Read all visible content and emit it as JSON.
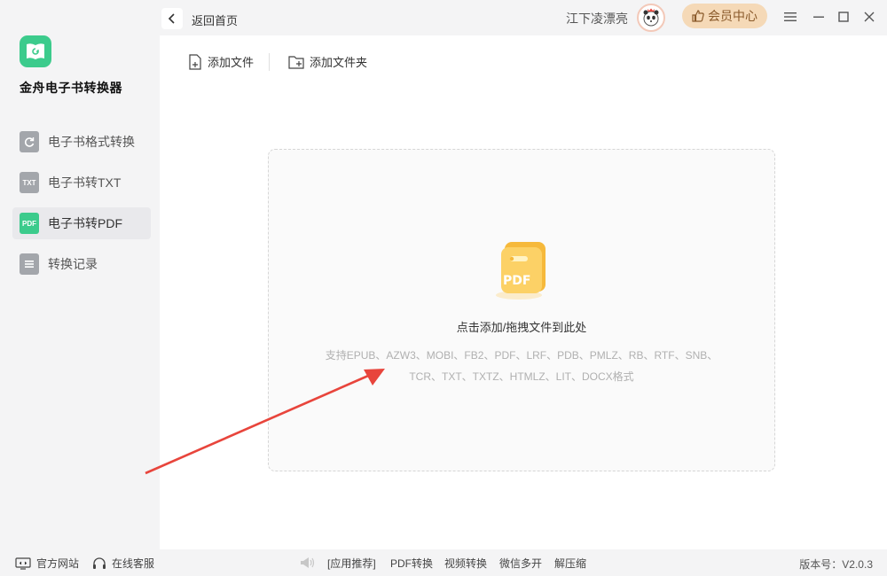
{
  "app": {
    "title": "金舟电子书转换器"
  },
  "sidebar": {
    "items": [
      {
        "label": "电子书格式转换",
        "icon": "refresh-book-icon"
      },
      {
        "label": "电子书转TXT",
        "icon": "txt-icon",
        "badge": "TXT"
      },
      {
        "label": "电子书转PDF",
        "icon": "pdf-icon",
        "badge": "PDF",
        "active": true
      },
      {
        "label": "转换记录",
        "icon": "list-icon"
      }
    ]
  },
  "header": {
    "back_label": "返回首页",
    "username": "江下凌漂亮",
    "vip_label": "会员中心"
  },
  "toolbar": {
    "add_file": "添加文件",
    "add_folder": "添加文件夹"
  },
  "dropzone": {
    "icon_text": "PDF",
    "title": "点击添加/拖拽文件到此处",
    "formats_line1": "支持EPUB、AZW3、MOBI、FB2、PDF、LRF、PDB、PMLZ、RB、RTF、SNB、",
    "formats_line2": "TCR、TXT、TXTZ、HTMLZ、LIT、DOCX格式"
  },
  "footer": {
    "website": "官方网站",
    "support": "在线客服",
    "recommend": "[应用推荐]",
    "links": [
      "PDF转换",
      "视频转换",
      "微信多开",
      "解压缩"
    ],
    "version": "版本号：V2.0.3"
  },
  "colors": {
    "accent": "#3ccb8c",
    "vip_bg": "#f5d9b7",
    "arrow": "#e8453c"
  }
}
